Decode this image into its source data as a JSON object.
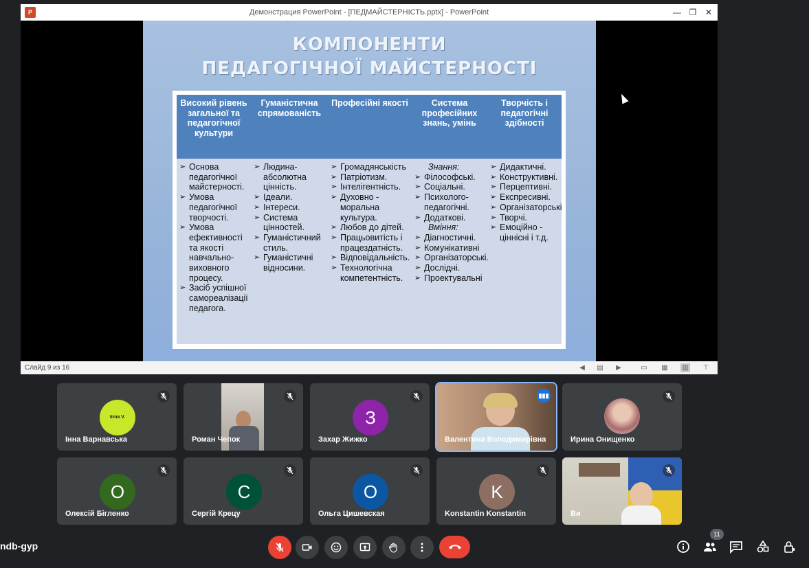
{
  "window": {
    "title": "Демонстрация PowerPoint - [ПЕДМАЙСТЕРНІСТЬ.pptx] - PowerPoint",
    "status": "Слайд 9 из 16"
  },
  "slide": {
    "title_line1": "КОМПОНЕНТИ",
    "title_line2": "ПЕДАГОГІЧНОЇ МАЙСТЕРНОСТІ",
    "columns": [
      {
        "header": "Високий рівень загальної та педагогічної культури",
        "items": [
          {
            "text": "Основа педагогічної майстерності."
          },
          {
            "text": "Умова педагогічної творчості."
          },
          {
            "text": "Умова ефективності та якості навчально-виховного процесу."
          },
          {
            "text": "Засіб успішної самореалізації педагога."
          }
        ]
      },
      {
        "header": "Гуманістична спрямованість",
        "items": [
          {
            "text": "Людина-абсолютна цінність."
          },
          {
            "text": "Ідеали."
          },
          {
            "text": "Інтереси."
          },
          {
            "text": "Система цінностей."
          },
          {
            "text": "Гуманістичний стиль."
          },
          {
            "text": "Гуманістичні відносини."
          }
        ]
      },
      {
        "header": "Професійні якості",
        "items": [
          {
            "text": "Громадянськість"
          },
          {
            "text": "Патріотизм."
          },
          {
            "text": "Інтелігентність."
          },
          {
            "text": "Духовно - моральна культура."
          },
          {
            "text": "Любов до дітей."
          },
          {
            "text": "Працьовитість і працездатність."
          },
          {
            "text": "Відповідальність."
          },
          {
            "text": "Технологічна компетентність."
          }
        ]
      },
      {
        "header": "Система професійних знань, умінь",
        "items": [
          {
            "text": "Знання:",
            "sub": true
          },
          {
            "text": "Філософські."
          },
          {
            "text": "Соціальні."
          },
          {
            "text": "Психолого-педагогічні."
          },
          {
            "text": "Додаткові."
          },
          {
            "text": "Вміння:",
            "sub": true
          },
          {
            "text": "Діагностичні."
          },
          {
            "text": "Комунікативні"
          },
          {
            "text": "Організаторські."
          },
          {
            "text": "Дослідні."
          },
          {
            "text": "Проектувальні"
          }
        ]
      },
      {
        "header": "Творчість і педагогічні здібності",
        "items": [
          {
            "text": "Дидактичні."
          },
          {
            "text": "Конструктивні."
          },
          {
            "text": "Перцептивні."
          },
          {
            "text": "Експресивні."
          },
          {
            "text": "Організаторські"
          },
          {
            "text": "Творчі."
          },
          {
            "text": "Емоційно - ціннісні і т.д."
          }
        ]
      }
    ]
  },
  "participants": [
    {
      "name": "Інна Варнавська",
      "avatar_text": "Inna V.",
      "avatar_color": "#c6e82a",
      "kind": "avatar",
      "muted": true
    },
    {
      "name": "Роман Чепок",
      "kind": "video",
      "muted": true
    },
    {
      "name": "Захар Жижко",
      "avatar_text": "З",
      "avatar_color": "#8e24aa",
      "kind": "avatar",
      "muted": true
    },
    {
      "name": "Валентина Володимирівна",
      "kind": "video",
      "speaking": true
    },
    {
      "name": "Ирина Онищенко",
      "kind": "photo",
      "muted": true
    },
    {
      "name": "Олексій Бігленко",
      "avatar_text": "О",
      "avatar_color": "#33691e",
      "kind": "avatar",
      "muted": true
    },
    {
      "name": "Сергій Крецу",
      "avatar_text": "С",
      "avatar_color": "#00513a",
      "kind": "avatar",
      "muted": true
    },
    {
      "name": "Ольга Цишевская",
      "avatar_text": "О",
      "avatar_color": "#0b57a4",
      "kind": "avatar",
      "muted": true
    },
    {
      "name": "Konstantin Konstantin",
      "avatar_text": "K",
      "avatar_color": "#8d6e63",
      "kind": "avatar",
      "muted": true
    },
    {
      "name": "Ви",
      "kind": "video",
      "muted": true
    }
  ],
  "meeting": {
    "code": "ndb-gyp",
    "participant_count": "11"
  },
  "colors": {
    "accent": "#8ab4f8",
    "danger": "#ea4335",
    "tile": "#3c4043",
    "background": "#202124"
  }
}
